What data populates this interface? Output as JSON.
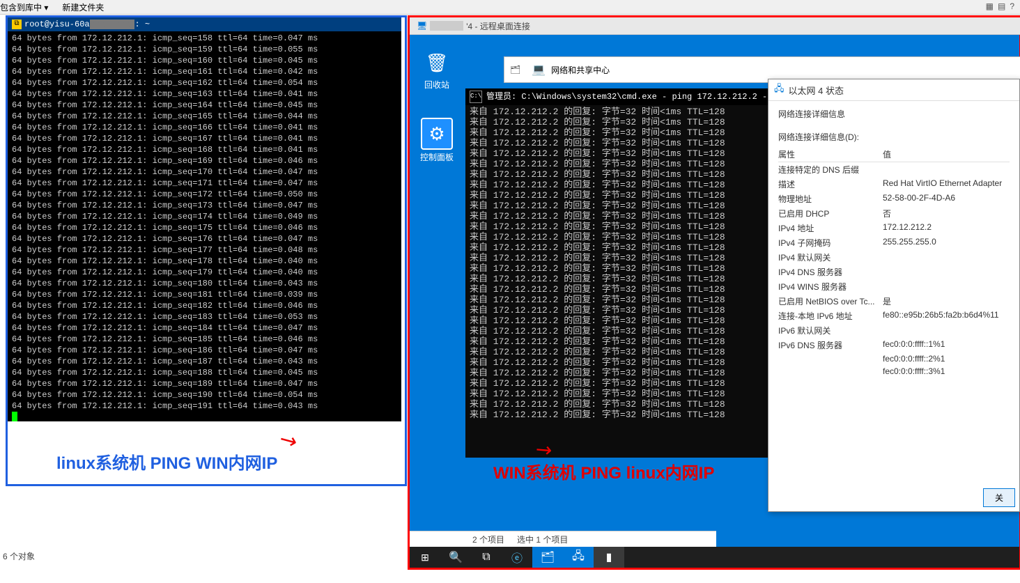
{
  "toolbar": {
    "include_to_lib": "包含到库中 ▾",
    "new_folder": "新建文件夹"
  },
  "top_right": {
    "view1": "▦",
    "view2": "▤",
    "help": "?"
  },
  "left": {
    "putty_title_prefix": "root@yisu-60a",
    "putty_title_suffix": ": ~",
    "ping_target": "172.12.212.1",
    "ping_lines": [
      {
        "seq": 158,
        "time": "0.047"
      },
      {
        "seq": 159,
        "time": "0.055"
      },
      {
        "seq": 160,
        "time": "0.045"
      },
      {
        "seq": 161,
        "time": "0.042"
      },
      {
        "seq": 162,
        "time": "0.054"
      },
      {
        "seq": 163,
        "time": "0.041"
      },
      {
        "seq": 164,
        "time": "0.045"
      },
      {
        "seq": 165,
        "time": "0.044"
      },
      {
        "seq": 166,
        "time": "0.041"
      },
      {
        "seq": 167,
        "time": "0.041"
      },
      {
        "seq": 168,
        "time": "0.041"
      },
      {
        "seq": 169,
        "time": "0.046"
      },
      {
        "seq": 170,
        "time": "0.047"
      },
      {
        "seq": 171,
        "time": "0.047"
      },
      {
        "seq": 172,
        "time": "0.050"
      },
      {
        "seq": 173,
        "time": "0.047"
      },
      {
        "seq": 174,
        "time": "0.049"
      },
      {
        "seq": 175,
        "time": "0.046"
      },
      {
        "seq": 176,
        "time": "0.047"
      },
      {
        "seq": 177,
        "time": "0.048"
      },
      {
        "seq": 178,
        "time": "0.040"
      },
      {
        "seq": 179,
        "time": "0.040"
      },
      {
        "seq": 180,
        "time": "0.043"
      },
      {
        "seq": 181,
        "time": "0.039"
      },
      {
        "seq": 182,
        "time": "0.046"
      },
      {
        "seq": 183,
        "time": "0.053"
      },
      {
        "seq": 184,
        "time": "0.047"
      },
      {
        "seq": 185,
        "time": "0.046"
      },
      {
        "seq": 186,
        "time": "0.047"
      },
      {
        "seq": 187,
        "time": "0.043"
      },
      {
        "seq": 188,
        "time": "0.045"
      },
      {
        "seq": 189,
        "time": "0.047"
      },
      {
        "seq": 190,
        "time": "0.054"
      },
      {
        "seq": 191,
        "time": "0.043"
      }
    ],
    "caption": "linux系统机 PING WIN内网IP"
  },
  "right": {
    "rdp_title": "'4 - 远程桌面连接",
    "recycle_label": "回收站",
    "control_panel_label": "控制面板",
    "explorer_breadcrumb": "网络和共享中心",
    "cmd_title": "管理员: C:\\Windows\\system32\\cmd.exe - ping  172.12.212.2 -t",
    "cmd_source_ip": "172.12.212.2",
    "cmd_line_template": "来自 172.12.212.2 的回复: 字节=32 时间<1ms TTL=128",
    "cmd_line_count": 30,
    "status_dialog": {
      "title": "以太网 4 状态",
      "section_title": "网络连接详细信息",
      "d_label": "网络连接详细信息(D):",
      "header_prop": "属性",
      "header_val": "值",
      "rows": [
        {
          "k": "连接特定的 DNS 后缀",
          "v": ""
        },
        {
          "k": "描述",
          "v": "Red Hat VirtIO Ethernet Adapter"
        },
        {
          "k": "物理地址",
          "v": "52-58-00-2F-4D-A6"
        },
        {
          "k": "已启用 DHCP",
          "v": "否"
        },
        {
          "k": "IPv4 地址",
          "v": "172.12.212.2"
        },
        {
          "k": "IPv4 子网掩码",
          "v": "255.255.255.0"
        },
        {
          "k": "IPv4 默认网关",
          "v": ""
        },
        {
          "k": "IPv4 DNS 服务器",
          "v": ""
        },
        {
          "k": "IPv4 WINS 服务器",
          "v": ""
        },
        {
          "k": "已启用 NetBIOS over Tc...",
          "v": "是"
        },
        {
          "k": "连接-本地 IPv6 地址",
          "v": "fe80::e95b:26b5:fa2b:b6d4%11"
        },
        {
          "k": "IPv6 默认网关",
          "v": ""
        },
        {
          "k": "IPv6 DNS 服务器",
          "v": "fec0:0:0:ffff::1%1"
        },
        {
          "k": "",
          "v": "fec0:0:0:ffff::2%1"
        },
        {
          "k": "",
          "v": "fec0:0:0:ffff::3%1"
        }
      ],
      "close_btn": "关"
    },
    "caption": "WIN系统机 PING linux内网IP",
    "explorer_status": {
      "items": "2 个项目",
      "selected": "选中 1 个项目"
    }
  },
  "left_status": "6 个对象"
}
